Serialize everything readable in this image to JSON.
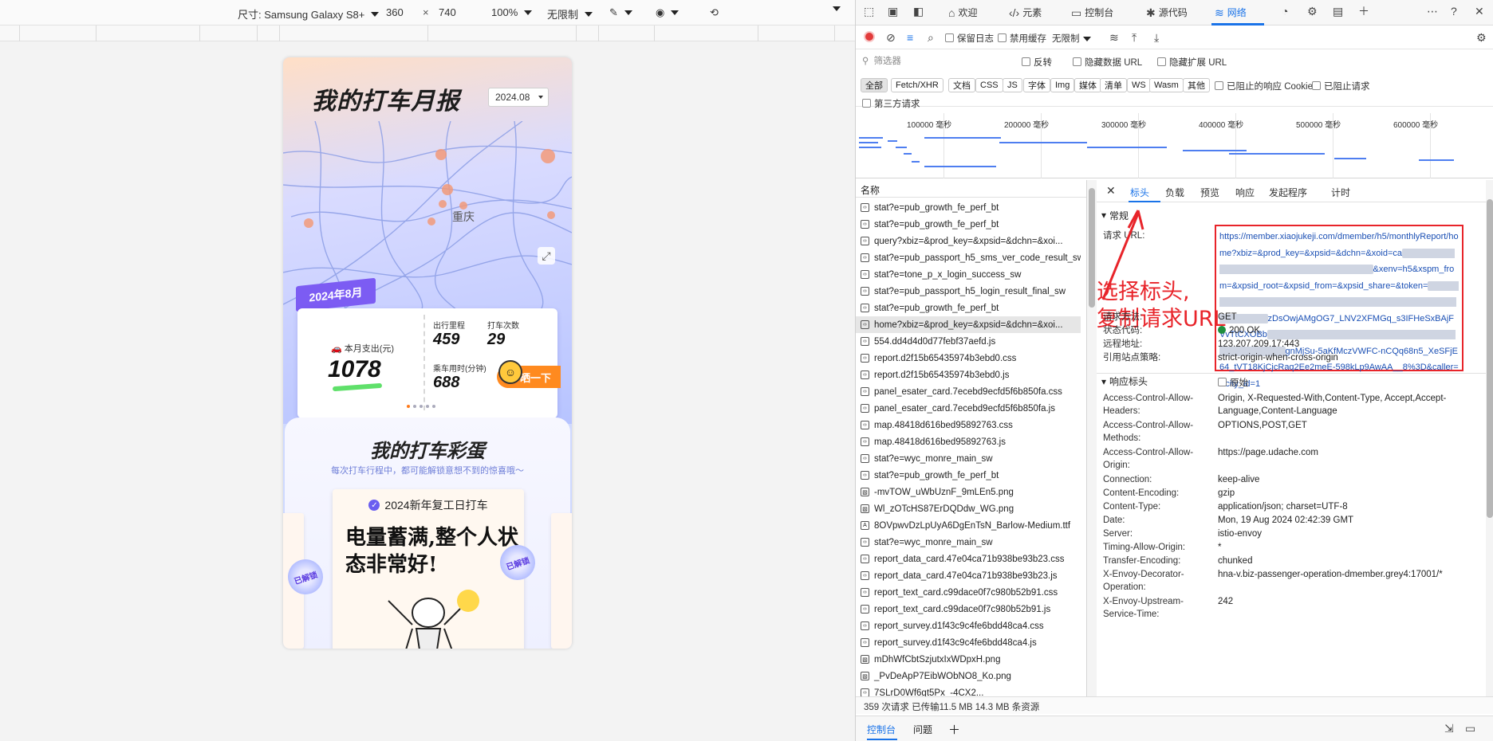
{
  "emulator": {
    "device_label": "尺寸: Samsung Galaxy S8+",
    "width": "360",
    "times": "×",
    "height": "740",
    "zoom": "100%",
    "throttle": "无限制"
  },
  "phone": {
    "title": "我的打车月报",
    "month_select": "2024.08",
    "city": "重庆",
    "ribbon": "2024年8月",
    "spend_label": "本月支出(元)",
    "spend_value": "1078",
    "distance_label": "出行里程",
    "distance_value": "459",
    "trips_label": "打车次数",
    "trips_value": "29",
    "time_label": "乘车用时(分钟)",
    "time_value": "688",
    "share_label": "晒一下",
    "egg_title": "我的打车彩蛋",
    "egg_sub": "每次打车行程中，都可能解锁意想不到的惊喜哦～",
    "egg_card_head": "2024新年复工日打车",
    "egg_card_big": "电量蓄满,整个人状态非常好!",
    "unlock_label": "已解锁"
  },
  "devtools": {
    "tabs": [
      {
        "label": "欢迎",
        "icon": "home-icon"
      },
      {
        "label": "元素",
        "icon": "code-icon"
      },
      {
        "label": "控制台",
        "icon": "console-icon"
      },
      {
        "label": "源代码",
        "icon": "bug-icon"
      },
      {
        "label": "网络",
        "icon": "wifi-icon"
      }
    ],
    "toolbar": {
      "preserve_log": "保留日志",
      "disable_cache": "禁用缓存",
      "throttle": "无限制"
    },
    "filter": {
      "placeholder": "筛选器",
      "invert": "反转",
      "hide_data_url": "隐藏数据 URL",
      "hide_ext_url": "隐藏扩展 URL"
    },
    "types": [
      "全部",
      "Fetch/XHR",
      "文档",
      "CSS",
      "JS",
      "字体",
      "Img",
      "媒体",
      "清单",
      "WS",
      "Wasm",
      "其他"
    ],
    "blocked_cookie": "已阻止的响应 Cookie",
    "blocked_req": "已阻止请求",
    "third_party": "第三方请求",
    "overview_ticks": [
      "100000 毫秒",
      "200000 毫秒",
      "300000 毫秒",
      "400000 毫秒",
      "500000 毫秒",
      "600000 毫秒"
    ],
    "name_header": "名称",
    "requests": [
      "stat?e=pub_growth_fe_perf_bt",
      "stat?e=pub_growth_fe_perf_bt",
      "query?xbiz=&prod_key=&xpsid=&dchn=&xoi...",
      "stat?e=pub_passport_h5_sms_ver_code_result_sw",
      "stat?e=tone_p_x_login_success_sw",
      "stat?e=pub_passport_h5_login_result_final_sw",
      "stat?e=pub_growth_fe_perf_bt",
      "home?xbiz=&prod_key=&xpsid=&dchn=&xoi...",
      "554.dd4d4d0d77febf37aefd.js",
      "report.d2f15b65435974b3ebd0.css",
      "report.d2f15b65435974b3ebd0.js",
      "panel_esater_card.7ecebd9ecfd5f6b850fa.css",
      "panel_esater_card.7ecebd9ecfd5f6b850fa.js",
      "map.48418d616bed95892763.css",
      "map.48418d616bed95892763.js",
      "stat?e=wyc_monre_main_sw",
      "stat?e=pub_growth_fe_perf_bt",
      "-mvTOW_uWbUznF_9mLEn5.png",
      "Wl_zOTcHS87ErDQDdw_WG.png",
      "8OVpwvDzLpUyA6DgEnTsN_Barlow-Medium.ttf",
      "stat?e=wyc_monre_main_sw",
      "report_data_card.47e04ca71b938be93b23.css",
      "report_data_card.47e04ca71b938be93b23.js",
      "report_text_card.c99dace0f7c980b52b91.css",
      "report_text_card.c99dace0f7c980b52b91.js",
      "report_survey.d1f43c9c4fe6bdd48ca4.css",
      "report_survey.d1f43c9c4fe6bdd48ca4.js",
      "mDhWfCbtSzjutxIxWDpxH.png",
      "_PvDeApP7EibWObNO8_Ko.png",
      "7SLrD0Wf6gt5Px_-4CX2..."
    ],
    "detail_tabs": [
      "标头",
      "负载",
      "预览",
      "响应",
      "发起程序",
      "计时"
    ],
    "general_header": "常规",
    "request_url_label": "请求 URL:",
    "url_parts": [
      "https://member.xiaojukeji.com/dmember/h5/monthlyReport/home?xbiz=&prod_key=&xpsid=&dchn=&xoid=ca",
      "&xenv=h5&xspm_from=&xpsid_root=&xpsid_from=&xpsid_share=&token=",
      "zDsOwjAMgOG7_LNV2XFMGq_s3IFHeSxBAjFVvTtCXOBb",
      "gnMjSu-5aKfMczVWFC-nCQq68n5_XeSFjE64_tVT18KjCjcRaq2Ee2meE-598kLp9AwAA__8%3D&caller=&city_id=1"
    ],
    "annotation": "选择标头,\n复制请求URL",
    "general": [
      {
        "k": "请求方法:",
        "v": "GET"
      },
      {
        "k": "状态代码:",
        "v": "200 OK"
      },
      {
        "k": "远程地址:",
        "v": "123.207.209.17:443"
      },
      {
        "k": "引用站点策略:",
        "v": "strict-origin-when-cross-origin"
      }
    ],
    "response_header": "响应标头",
    "raw_label": "原始",
    "response": [
      {
        "k": "Access-Control-Allow-Headers:",
        "v": "Origin, X-Requested-With,Content-Type, Accept,Accept-Language,Content-Language"
      },
      {
        "k": "Access-Control-Allow-Methods:",
        "v": "OPTIONS,POST,GET"
      },
      {
        "k": "Access-Control-Allow-Origin:",
        "v": "https://page.udache.com"
      },
      {
        "k": "Connection:",
        "v": "keep-alive"
      },
      {
        "k": "Content-Encoding:",
        "v": "gzip"
      },
      {
        "k": "Content-Type:",
        "v": "application/json; charset=UTF-8"
      },
      {
        "k": "Date:",
        "v": "Mon, 19 Aug 2024 02:42:39 GMT"
      },
      {
        "k": "Server:",
        "v": "istio-envoy"
      },
      {
        "k": "Timing-Allow-Origin:",
        "v": "*"
      },
      {
        "k": "Transfer-Encoding:",
        "v": "chunked"
      },
      {
        "k": "X-Envoy-Decorator-Operation:",
        "v": "hna-v.biz-passenger-operation-dmember.grey4:17001/*"
      },
      {
        "k": "X-Envoy-Upstream-Service-Time:",
        "v": "242"
      }
    ],
    "status_bar": "359 次请求  已传输11.5 MB  14.3 MB 条资源",
    "drawer_tabs": [
      "控制台",
      "问题"
    ],
    "accent": "#1a73e8",
    "annotation_color": "#e8242a"
  }
}
